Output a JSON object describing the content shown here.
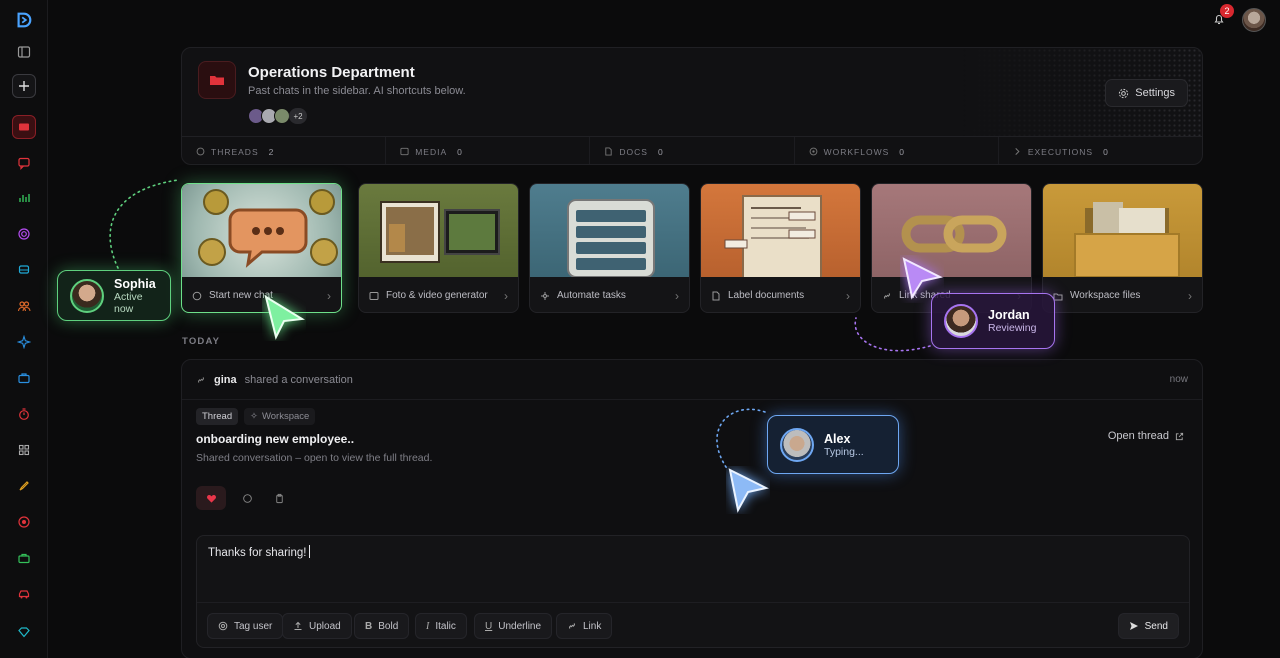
{
  "header": {
    "title": "Operations Department",
    "subtitle": "Past chats in the sidebar.  AI shortcuts below.",
    "member_more": "+2",
    "settings_label": "Settings",
    "notification_count": "2",
    "stats": [
      {
        "label": "THREADS",
        "value": "2"
      },
      {
        "label": "MEDIA",
        "value": "0"
      },
      {
        "label": "DOCS",
        "value": "0"
      },
      {
        "label": "WORKFLOWS",
        "value": "0"
      },
      {
        "label": "EXECUTIONS",
        "value": "0"
      }
    ]
  },
  "shortcuts": [
    {
      "label": "Start new chat",
      "icon": "chat-icon"
    },
    {
      "label": "Foto & video generator",
      "icon": "image-icon"
    },
    {
      "label": "Automate tasks",
      "icon": "automation-icon"
    },
    {
      "label": "Label documents",
      "icon": "document-icon"
    },
    {
      "label": "Link shared",
      "icon": "link-icon"
    },
    {
      "label": "Workspace files",
      "icon": "folder-icon"
    }
  ],
  "feed": {
    "section_label": "TODAY",
    "user": "gina",
    "action": "shared a conversation",
    "time": "now",
    "tag_thread": "Thread",
    "tag_workspace": "Workspace",
    "title": "onboarding new employee..",
    "subtitle": "Shared conversation – open to view the full thread.",
    "open_label": "Open thread"
  },
  "composer": {
    "text": "Thanks for sharing!",
    "buttons": [
      "Tag user",
      "Upload",
      "Bold",
      "Italic",
      "Underline",
      "Link"
    ],
    "send_label": "Send"
  },
  "presence": [
    {
      "name": "Sophia",
      "status": "Active now",
      "color": "#5fd07e"
    },
    {
      "name": "Jordan",
      "status": "Reviewing",
      "color": "#a774f0"
    },
    {
      "name": "Alex",
      "status": "Typing...",
      "color": "#6ea7f2"
    }
  ],
  "colors": {
    "accent_red": "#d8282f",
    "bg": "#0b0b0c"
  }
}
